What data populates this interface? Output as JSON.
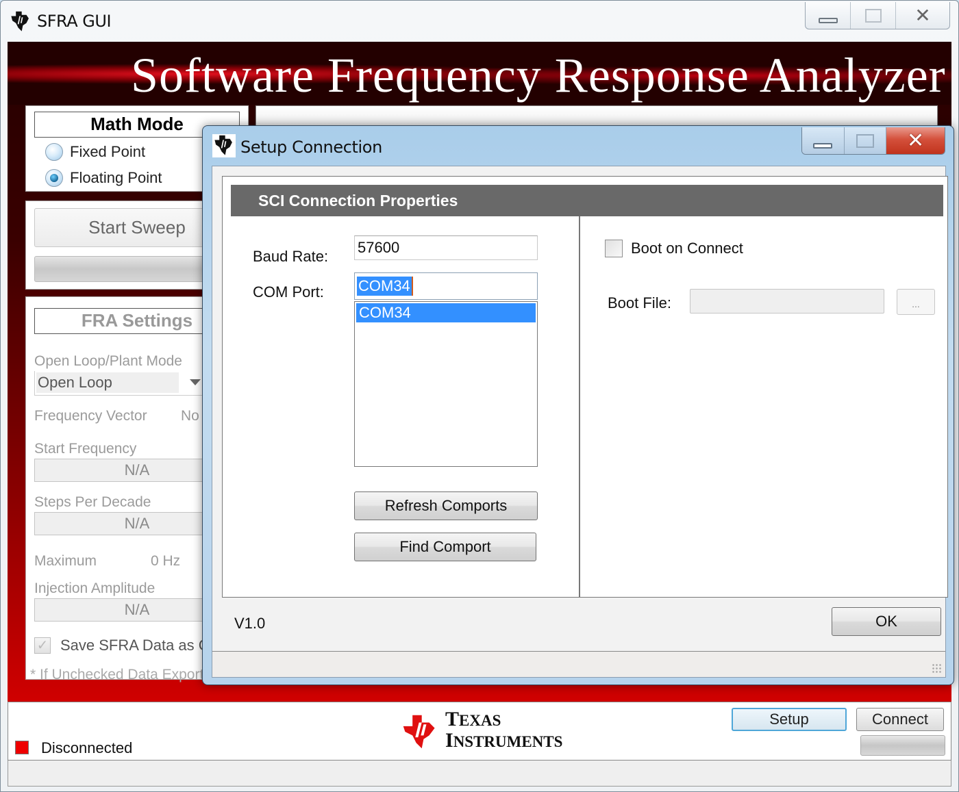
{
  "main_window": {
    "title": "SFRA GUI",
    "banner_title": "Software Frequency Response Analyzer",
    "caption_buttons": [
      "minimize",
      "maximize",
      "close"
    ]
  },
  "math_mode": {
    "header": "Math Mode",
    "options": [
      {
        "label": "Fixed Point",
        "selected": false
      },
      {
        "label": "Floating Point",
        "selected": true
      }
    ]
  },
  "sweep": {
    "start_label": "Start Sweep",
    "progress": 0
  },
  "fra_settings": {
    "header": "FRA Settings",
    "mode_label": "Open Loop/Plant Mode",
    "mode_value": "Open Loop",
    "freq_vector_label": "Frequency Vector",
    "freq_vector_value": "No",
    "start_freq_label": "Start Frequency",
    "start_freq_value": "N/A",
    "steps_label": "Steps Per Decade",
    "steps_value": "N/A",
    "max_label": "Maximum",
    "max_value": "0 Hz",
    "injection_label": "Injection Amplitude",
    "injection_value": "N/A",
    "save_label": "Save SFRA Data as CSV",
    "save_checked": true,
    "save_note": "* If Unchecked Data Exported"
  },
  "status": {
    "led_color": "#ee0000",
    "text": "Disconnected"
  },
  "logo": {
    "line1": "Texas",
    "line2": "Instruments"
  },
  "bottom_buttons": {
    "setup": "Setup",
    "connect": "Connect"
  },
  "dialog": {
    "title": "Setup Connection",
    "section_header": "SCI Connection Properties",
    "baud_label": "Baud Rate:",
    "baud_value": "57600",
    "com_label": "COM Port:",
    "com_value": "COM34",
    "com_options": [
      "COM34"
    ],
    "refresh_button": "Refresh Comports",
    "find_button": "Find Comport",
    "boot_on_connect_label": "Boot on Connect",
    "boot_on_connect_checked": false,
    "boot_file_label": "Boot File:",
    "boot_file_value": "",
    "browse_button": "...",
    "version": "V1.0",
    "ok_button": "OK"
  },
  "colors": {
    "accent_red": "#cc0000",
    "selection_blue": "#3390ff",
    "header_gray": "#696969"
  }
}
